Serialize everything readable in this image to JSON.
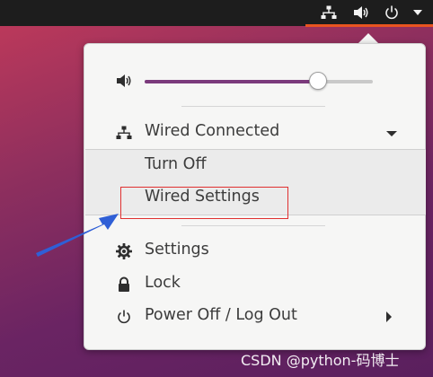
{
  "topbar": {
    "icons": [
      "network-wired-icon",
      "volume-icon",
      "power-icon",
      "menu-caret-icon"
    ]
  },
  "menu": {
    "volume": {
      "icon": "volume-icon",
      "level_fraction": 0.76
    },
    "network": {
      "icon": "network-wired-icon",
      "label": "Wired Connected",
      "submenu": {
        "turn_off": "Turn Off",
        "wired_settings": "Wired Settings"
      }
    },
    "settings": {
      "icon": "gear-icon",
      "label": "Settings"
    },
    "lock": {
      "icon": "lock-icon",
      "label": "Lock"
    },
    "power": {
      "icon": "power-icon",
      "label": "Power Off / Log Out"
    }
  },
  "annotation": {
    "highlight_color": "#e03030",
    "arrow_color": "#2f5fd6"
  },
  "watermark": "CSDN @python-码博士",
  "colors": {
    "accent": "#e95420",
    "slider_fill": "#7b3a7c",
    "menu_bg": "#f6f6f5",
    "topbar_bg": "#1d1d1d"
  }
}
